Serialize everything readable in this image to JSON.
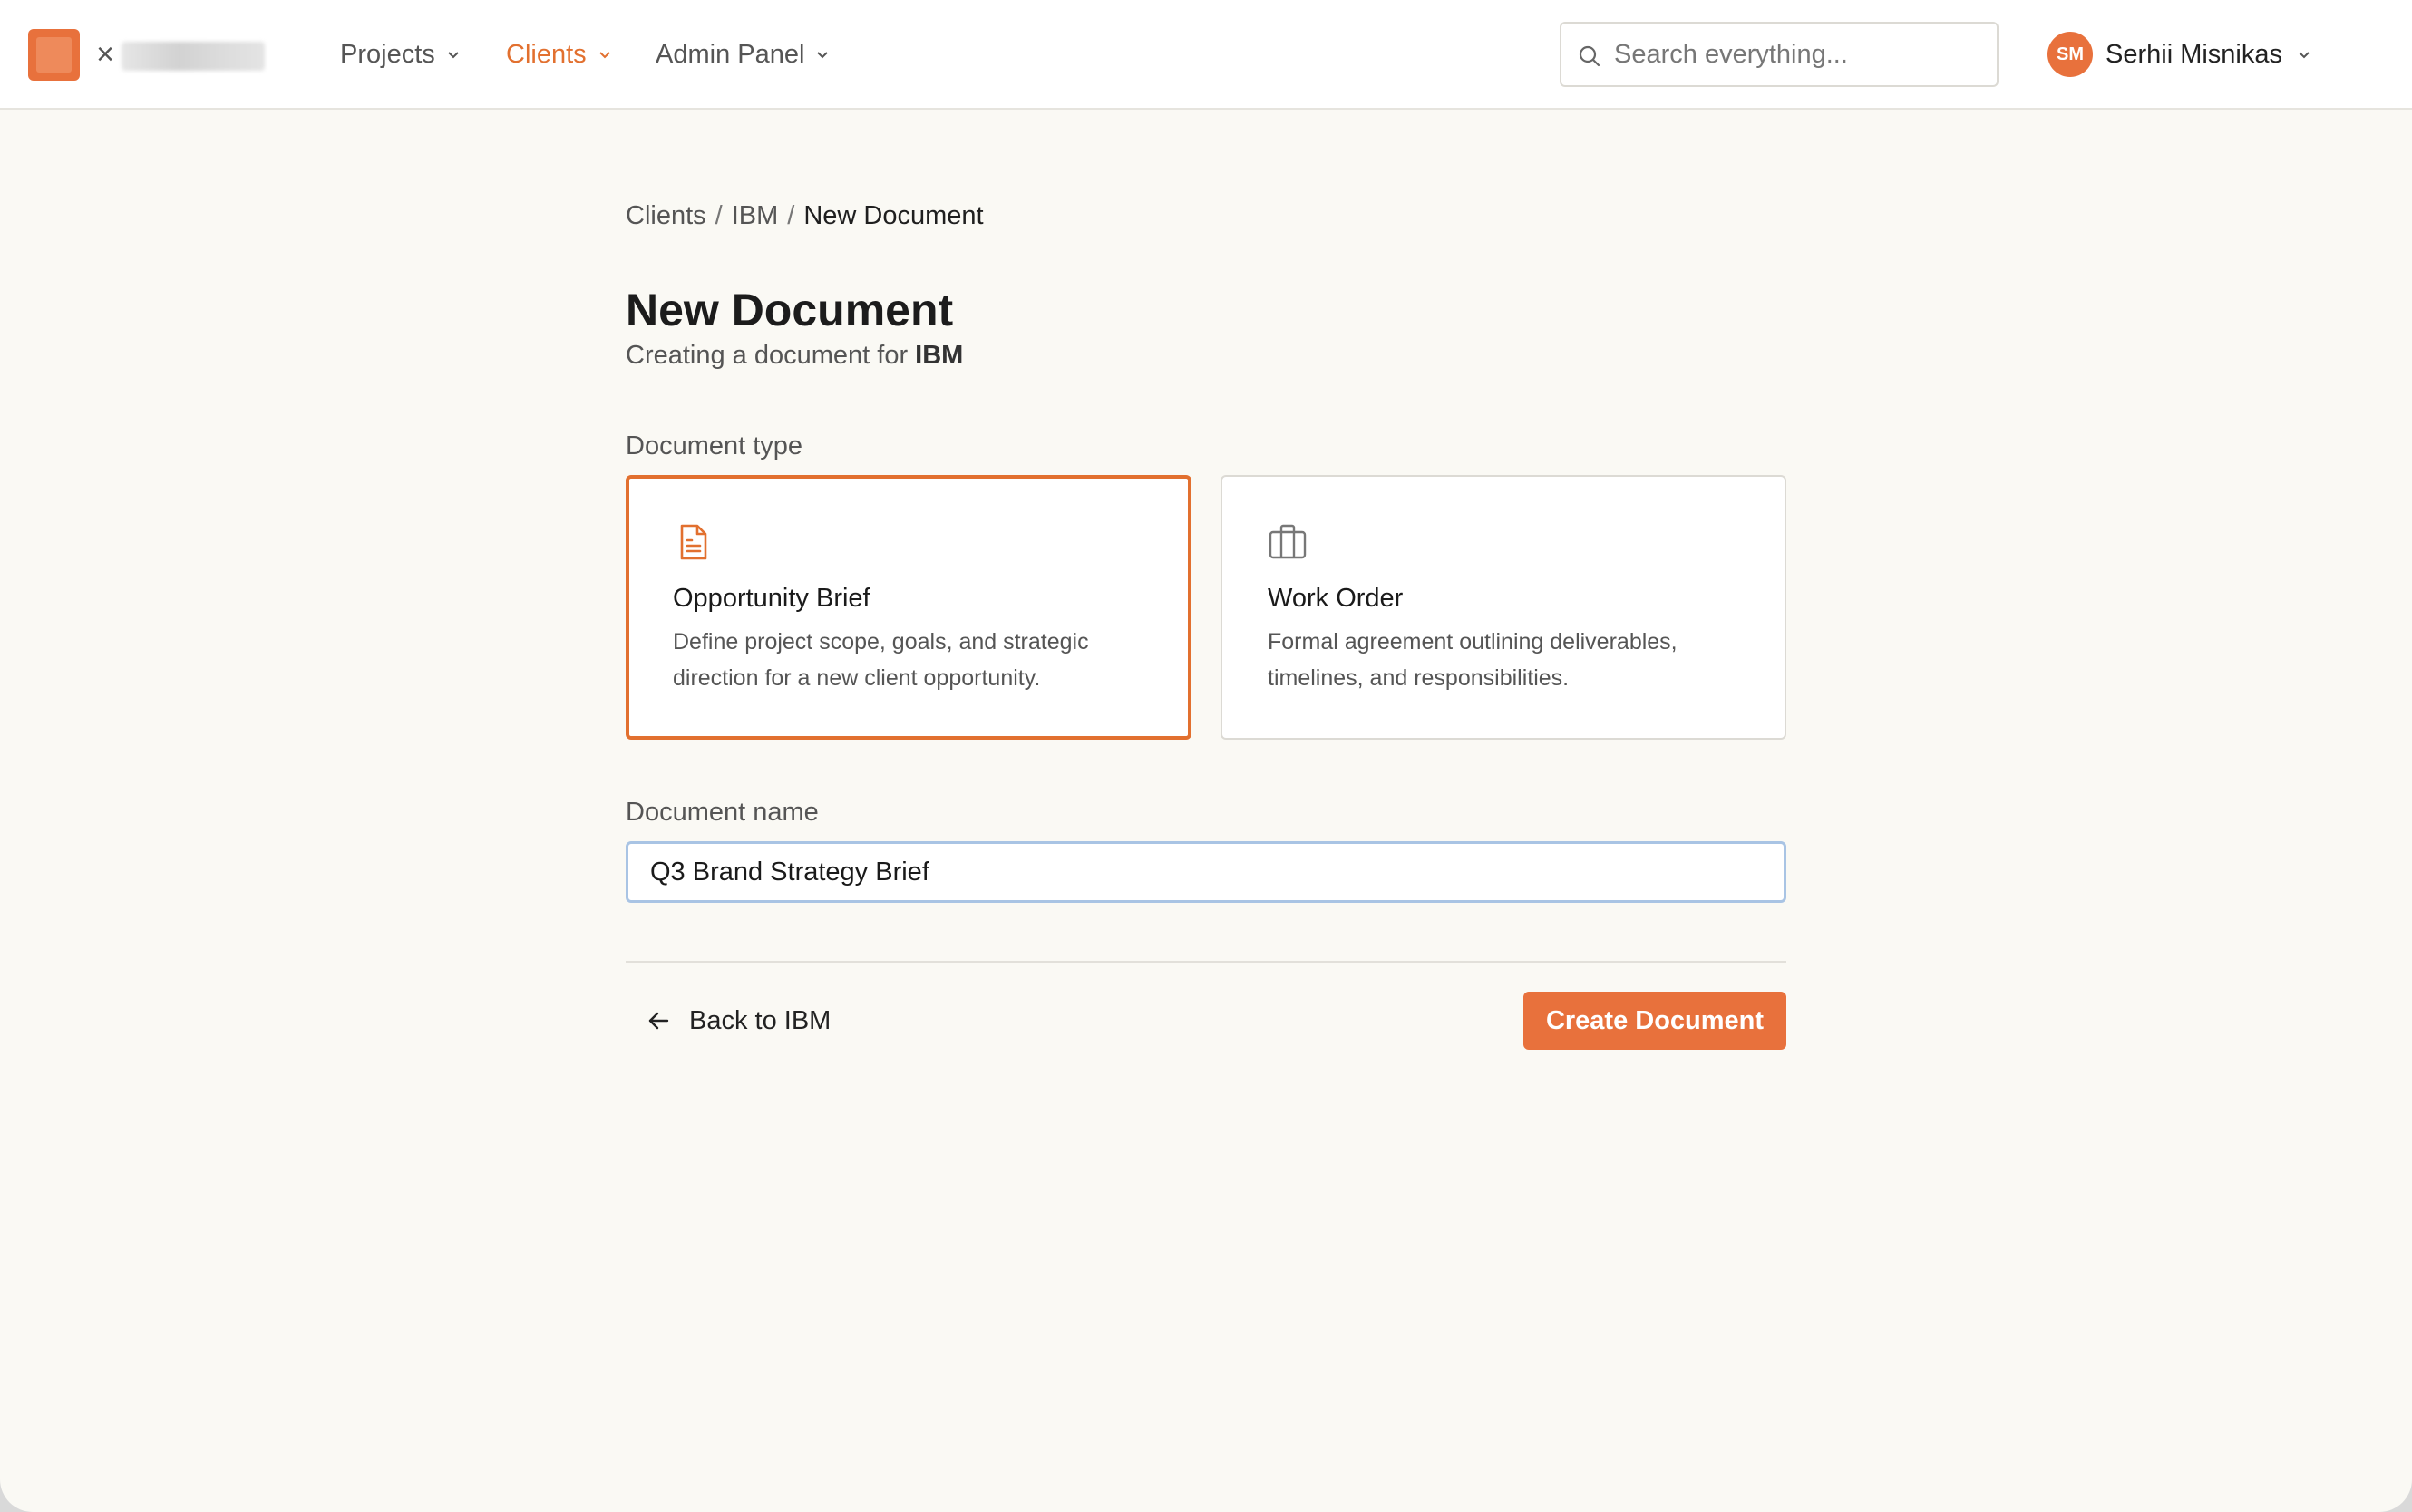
{
  "nav": {
    "items": [
      {
        "label": "Projects"
      },
      {
        "label": "Clients"
      },
      {
        "label": "Admin Panel"
      }
    ],
    "search_placeholder": "Search everything...",
    "user": {
      "initials": "SM",
      "name": "Serhii Misnikas"
    }
  },
  "breadcrumb": {
    "items": [
      "Clients",
      "IBM"
    ],
    "current": "New Document"
  },
  "page": {
    "title": "New Document",
    "subtitle_prefix": "Creating a document for ",
    "subtitle_client": "IBM"
  },
  "doc_type": {
    "label": "Document type",
    "options": [
      {
        "title": "Opportunity Brief",
        "description": "Define project scope, goals, and strategic direction for a new client opportunity.",
        "icon": "document-icon",
        "selected": true
      },
      {
        "title": "Work Order",
        "description": "Formal agreement outlining deliverables, timelines, and responsibilities.",
        "icon": "briefcase-icon",
        "selected": false
      }
    ]
  },
  "doc_name": {
    "label": "Document name",
    "value": "Q3 Brand Strategy Brief"
  },
  "actions": {
    "back_label": "Back to IBM",
    "create_label": "Create Document"
  },
  "colors": {
    "accent": "#e8713c",
    "accent_text": "#e2702f",
    "background": "#faf9f4"
  }
}
